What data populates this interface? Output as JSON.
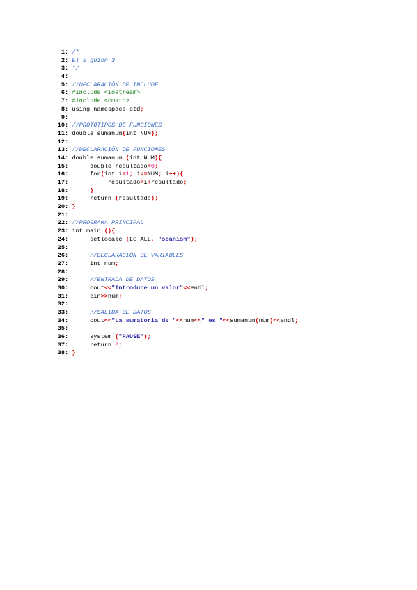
{
  "colors": {
    "comment": "#3a68c2",
    "preprocessor": "#1c7f1c",
    "number": "#e0138b",
    "string": "#2d2aa8",
    "operator": "#d40000",
    "default": "#000000"
  },
  "lines": [
    {
      "n": "1",
      "tokens": [
        {
          "t": "/*",
          "c": "comment"
        }
      ]
    },
    {
      "n": "2",
      "tokens": [
        {
          "t": "Ej 5 guion 3",
          "c": "comment"
        }
      ]
    },
    {
      "n": "3",
      "tokens": [
        {
          "t": "*/",
          "c": "comment"
        }
      ]
    },
    {
      "n": "4",
      "tokens": []
    },
    {
      "n": "5",
      "tokens": [
        {
          "t": "//DECLARACIÓN DE INCLUDE",
          "c": "comment"
        }
      ]
    },
    {
      "n": "6",
      "tokens": [
        {
          "t": "#include <iostream>",
          "c": "prep"
        }
      ]
    },
    {
      "n": "7",
      "tokens": [
        {
          "t": "#include <cmath>",
          "c": "prep"
        }
      ]
    },
    {
      "n": "8",
      "tokens": [
        {
          "t": "using namespace std",
          "c": "plain"
        },
        {
          "t": ";",
          "c": "op"
        }
      ]
    },
    {
      "n": "9",
      "tokens": []
    },
    {
      "n": "10",
      "tokens": [
        {
          "t": "//PROTOTIPOS DE FUNCIONES",
          "c": "comment"
        }
      ]
    },
    {
      "n": "11",
      "tokens": [
        {
          "t": "double sumanum",
          "c": "plain"
        },
        {
          "t": "(",
          "c": "op"
        },
        {
          "t": "int NUM",
          "c": "plain"
        },
        {
          "t": ");",
          "c": "op"
        }
      ]
    },
    {
      "n": "12",
      "tokens": []
    },
    {
      "n": "13",
      "tokens": [
        {
          "t": "//DECLARACIÓN DE FUNCIONES",
          "c": "comment"
        }
      ]
    },
    {
      "n": "14",
      "tokens": [
        {
          "t": "double sumanum ",
          "c": "plain"
        },
        {
          "t": "(",
          "c": "op"
        },
        {
          "t": "int NUM",
          "c": "plain"
        },
        {
          "t": "){",
          "c": "op"
        }
      ]
    },
    {
      "n": "15",
      "tokens": [
        {
          "t": "     double resultado",
          "c": "plain"
        },
        {
          "t": "=",
          "c": "op"
        },
        {
          "t": "0",
          "c": "num"
        },
        {
          "t": ";",
          "c": "op"
        }
      ]
    },
    {
      "n": "16",
      "tokens": [
        {
          "t": "     for",
          "c": "plain"
        },
        {
          "t": "(",
          "c": "op"
        },
        {
          "t": "int i",
          "c": "plain"
        },
        {
          "t": "=",
          "c": "op"
        },
        {
          "t": "1",
          "c": "num"
        },
        {
          "t": "; ",
          "c": "op"
        },
        {
          "t": "i",
          "c": "plain"
        },
        {
          "t": "<=",
          "c": "op"
        },
        {
          "t": "NUM",
          "c": "plain"
        },
        {
          "t": "; ",
          "c": "op"
        },
        {
          "t": "i",
          "c": "plain"
        },
        {
          "t": "++){",
          "c": "op"
        }
      ]
    },
    {
      "n": "17",
      "tokens": [
        {
          "t": "          resultado",
          "c": "plain"
        },
        {
          "t": "=",
          "c": "op"
        },
        {
          "t": "i",
          "c": "plain"
        },
        {
          "t": "+",
          "c": "op"
        },
        {
          "t": "resultado",
          "c": "plain"
        },
        {
          "t": ";",
          "c": "op"
        }
      ]
    },
    {
      "n": "18",
      "tokens": [
        {
          "t": "     }",
          "c": "op"
        }
      ]
    },
    {
      "n": "19",
      "tokens": [
        {
          "t": "     return ",
          "c": "plain"
        },
        {
          "t": "(",
          "c": "op"
        },
        {
          "t": "resultado",
          "c": "plain"
        },
        {
          "t": ");",
          "c": "op"
        }
      ]
    },
    {
      "n": "20",
      "tokens": [
        {
          "t": "}",
          "c": "op"
        }
      ]
    },
    {
      "n": "21",
      "tokens": []
    },
    {
      "n": "22",
      "tokens": [
        {
          "t": "//PROGRAMA PRINCIPAL",
          "c": "comment"
        }
      ]
    },
    {
      "n": "23",
      "tokens": [
        {
          "t": "int main ",
          "c": "plain"
        },
        {
          "t": "(){",
          "c": "op"
        }
      ]
    },
    {
      "n": "24",
      "tokens": [
        {
          "t": "     setlocale ",
          "c": "plain"
        },
        {
          "t": "(",
          "c": "op"
        },
        {
          "t": "LC_ALL",
          "c": "plain"
        },
        {
          "t": ", ",
          "c": "op"
        },
        {
          "t": "\"spanish\"",
          "c": "str"
        },
        {
          "t": ");",
          "c": "op"
        }
      ]
    },
    {
      "n": "25",
      "tokens": []
    },
    {
      "n": "26",
      "tokens": [
        {
          "t": "     //DECLARACIÓN DE VARIABLES",
          "c": "comment"
        }
      ]
    },
    {
      "n": "27",
      "tokens": [
        {
          "t": "     int num",
          "c": "plain"
        },
        {
          "t": ";",
          "c": "op"
        }
      ]
    },
    {
      "n": "28",
      "tokens": []
    },
    {
      "n": "29",
      "tokens": [
        {
          "t": "     //ENTRADA DE DATOS",
          "c": "comment"
        }
      ]
    },
    {
      "n": "30",
      "tokens": [
        {
          "t": "     cout",
          "c": "plain"
        },
        {
          "t": "<<",
          "c": "op"
        },
        {
          "t": "\"Introduce un valor\"",
          "c": "str"
        },
        {
          "t": "<<",
          "c": "op"
        },
        {
          "t": "endl",
          "c": "plain"
        },
        {
          "t": ";",
          "c": "op"
        }
      ]
    },
    {
      "n": "31",
      "tokens": [
        {
          "t": "     cin",
          "c": "plain"
        },
        {
          "t": ">>",
          "c": "op"
        },
        {
          "t": "num",
          "c": "plain"
        },
        {
          "t": ";",
          "c": "op"
        }
      ]
    },
    {
      "n": "32",
      "tokens": []
    },
    {
      "n": "33",
      "tokens": [
        {
          "t": "     //SALIDA DE DATOS",
          "c": "comment"
        }
      ]
    },
    {
      "n": "34",
      "tokens": [
        {
          "t": "     cout",
          "c": "plain"
        },
        {
          "t": "<<",
          "c": "op"
        },
        {
          "t": "\"La sumatoria de \"",
          "c": "str"
        },
        {
          "t": "<<",
          "c": "op"
        },
        {
          "t": "num",
          "c": "plain"
        },
        {
          "t": "<<",
          "c": "op"
        },
        {
          "t": "\" es \"",
          "c": "str"
        },
        {
          "t": "<<",
          "c": "op"
        },
        {
          "t": "sumanum",
          "c": "plain"
        },
        {
          "t": "(",
          "c": "op"
        },
        {
          "t": "num",
          "c": "plain"
        },
        {
          "t": ")",
          "c": "op"
        },
        {
          "t": "<<",
          "c": "op"
        },
        {
          "t": "endl",
          "c": "plain"
        },
        {
          "t": ";",
          "c": "op"
        }
      ]
    },
    {
      "n": "35",
      "tokens": []
    },
    {
      "n": "36",
      "tokens": [
        {
          "t": "     system ",
          "c": "plain"
        },
        {
          "t": "(",
          "c": "op"
        },
        {
          "t": "\"PAUSE\"",
          "c": "str"
        },
        {
          "t": ");",
          "c": "op"
        }
      ]
    },
    {
      "n": "37",
      "tokens": [
        {
          "t": "     return ",
          "c": "plain"
        },
        {
          "t": "0",
          "c": "num"
        },
        {
          "t": ";",
          "c": "op"
        }
      ]
    },
    {
      "n": "38",
      "tokens": [
        {
          "t": "}",
          "c": "op"
        }
      ]
    }
  ]
}
